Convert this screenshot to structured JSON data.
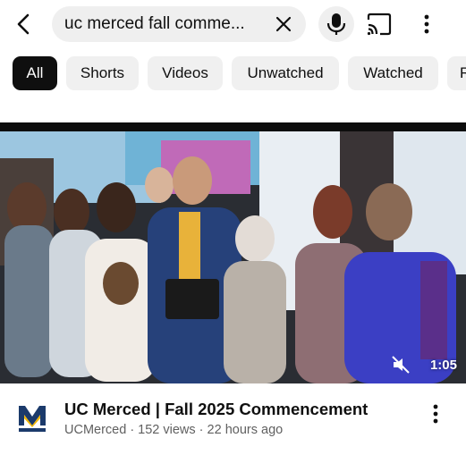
{
  "search": {
    "query": "uc merced fall comme..."
  },
  "icons": {
    "back": "arrow-left-icon",
    "clear": "close-icon",
    "mic": "microphone-icon",
    "cast": "cast-icon",
    "more": "more-vertical-icon",
    "mute": "muted-speaker-icon"
  },
  "chips": [
    {
      "label": "All",
      "active": true
    },
    {
      "label": "Shorts",
      "active": false
    },
    {
      "label": "Videos",
      "active": false
    },
    {
      "label": "Unwatched",
      "active": false
    },
    {
      "label": "Watched",
      "active": false
    },
    {
      "label": "R",
      "active": false
    }
  ],
  "video": {
    "duration": "1:05",
    "title": "UC Merced | Fall 2025 Commencement",
    "channel": "UCMerced",
    "views": "152 views",
    "age": "22 hours ago",
    "subtitle": "UCMerced · 152 views · 22 hours ago",
    "channel_logo_text": "UC MERCED"
  },
  "colors": {
    "chip_active_bg": "#0f0f0f",
    "chip_bg": "#f0f0f0",
    "logo_gold": "#f2b705",
    "logo_navy": "#1b3a6b"
  }
}
